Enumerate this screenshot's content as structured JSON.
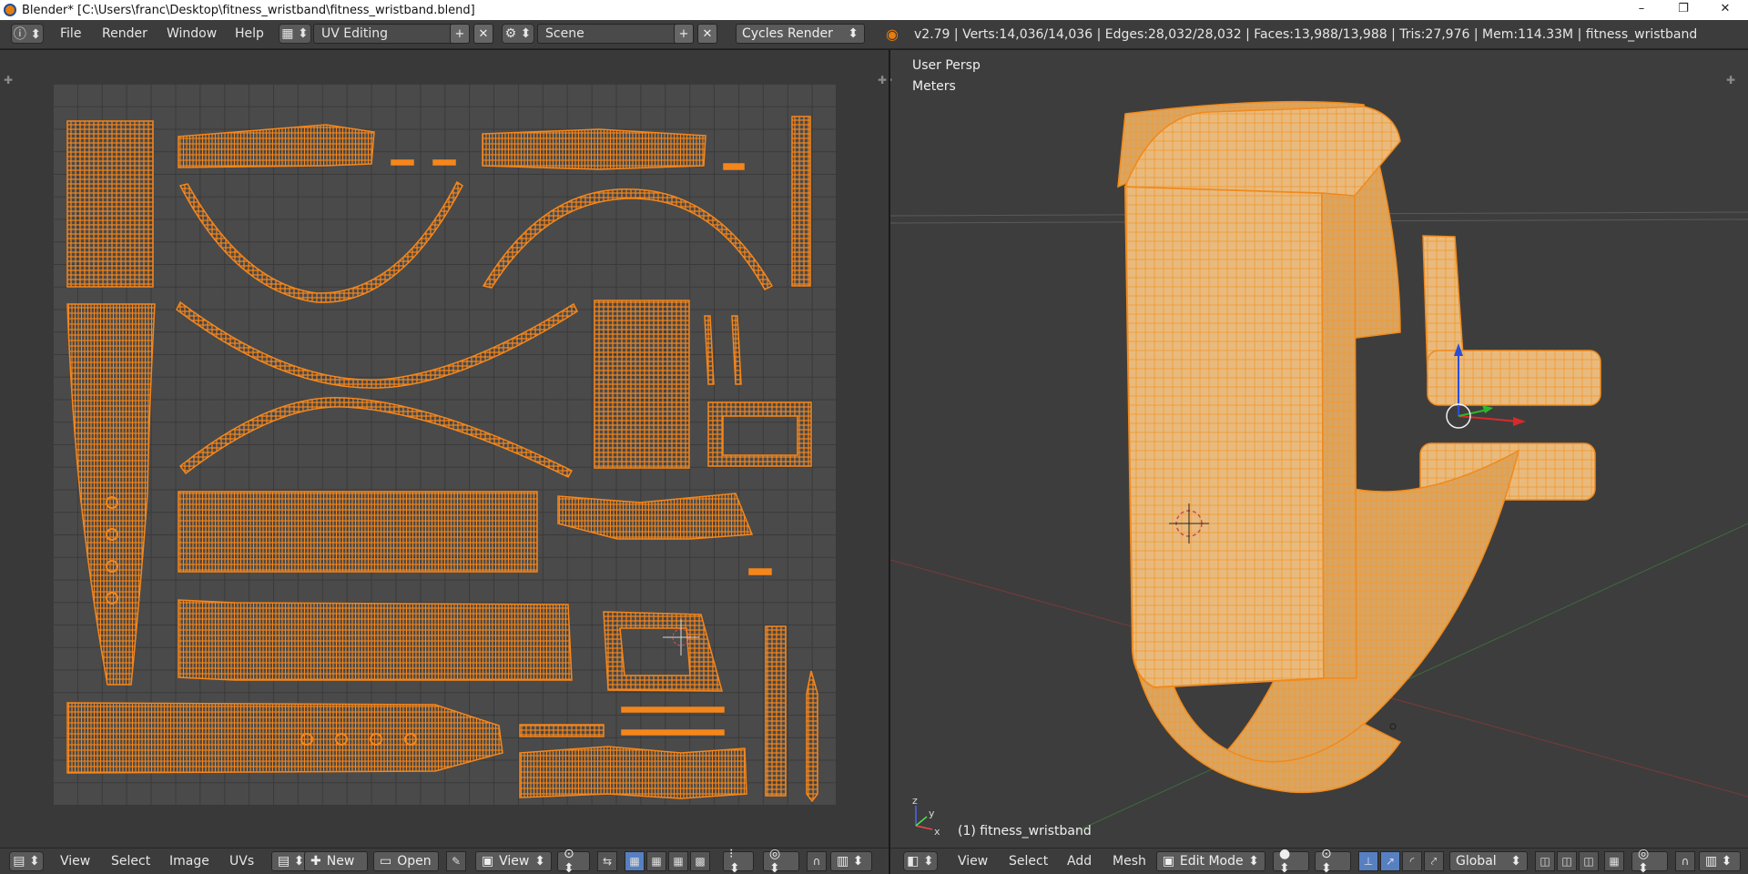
{
  "window": {
    "title": "Blender* [C:\\Users\\franc\\Desktop\\fitness_wristband\\fitness_wristband.blend]",
    "controls": [
      "–",
      "❐",
      "✕"
    ]
  },
  "info_header": {
    "menus": [
      "File",
      "Render",
      "Window",
      "Help"
    ],
    "screen_layout": "UV Editing",
    "scene": "Scene",
    "render_engine": "Cycles Render",
    "stats": "v2.79 | Verts:14,036/14,036 | Edges:28,032/28,032 | Faces:13,988/13,988 | Tris:27,976 | Mem:114.33M | fitness_wristband"
  },
  "viewport": {
    "view_label": "User Persp",
    "units_label": "Meters",
    "object_label": "(1) fitness_wristband"
  },
  "uv_header": {
    "menus": [
      "View",
      "Select",
      "Image",
      "UVs"
    ],
    "new_label": "New",
    "open_label": "Open",
    "view_select": "View"
  },
  "view3d_header": {
    "menus": [
      "View",
      "Select",
      "Add",
      "Mesh"
    ],
    "mode": "Edit Mode",
    "orientation": "Global"
  },
  "colors": {
    "accent": "#f08a1c",
    "uv_wire": "#f6861a",
    "mesh_face": "#e8b877",
    "selected_toggle": "#5680c2"
  }
}
